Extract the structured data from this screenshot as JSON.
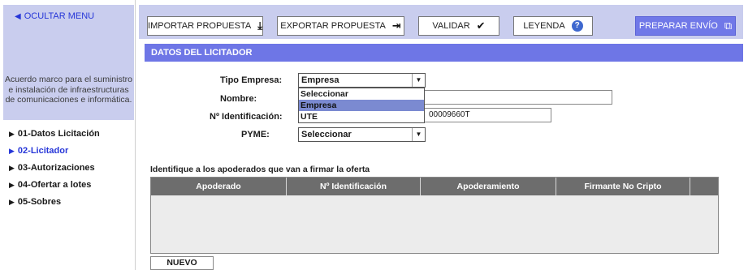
{
  "sidebar": {
    "hide_menu_label": "OCULTAR MENU",
    "contract_description": "Acuerdo marco para el suministro e instalación de infraestructuras de comunicaciones e informática.",
    "items": [
      {
        "label": "01-Datos Licitación",
        "active": false
      },
      {
        "label": "02-Licitador",
        "active": true
      },
      {
        "label": "03-Autorizaciones",
        "active": false
      },
      {
        "label": "04-Ofertar a lotes",
        "active": false
      },
      {
        "label": "05-Sobres",
        "active": false
      }
    ]
  },
  "toolbar": {
    "import_label": "IMPORTAR PROPUESTA",
    "export_label": "EXPORTAR PROPUESTA",
    "validate_label": "VALIDAR",
    "legend_label": "LEYENDA",
    "prepare_label": "PREPARAR ENVÍO"
  },
  "section": {
    "title": "DATOS DEL LICITADOR"
  },
  "form": {
    "tipo_empresa_label": "Tipo Empresa:",
    "tipo_empresa_value": "Empresa",
    "nombre_label": "Nombre:",
    "nombre_value": "",
    "identificacion_label": "Nº Identificación:",
    "identificacion_value": "00009660T",
    "pyme_label": "PYME:",
    "pyme_value": "Seleccionar",
    "dropdown_options": [
      "Seleccionar",
      "Empresa",
      "UTE"
    ],
    "dropdown_selected": "Empresa"
  },
  "apoderados": {
    "instruction": "Identifique a los apoderados que van a firmar la oferta",
    "columns": [
      "Apoderado",
      "Nº Identificación",
      "Apoderamiento",
      "Firmante No Cripto",
      ""
    ],
    "rows": [],
    "new_button_label": "NUEVO"
  },
  "colors": {
    "accent_light": "#c9cdee",
    "accent": "#6e76e6",
    "link": "#2636d8",
    "table_header": "#6d6d6d"
  }
}
